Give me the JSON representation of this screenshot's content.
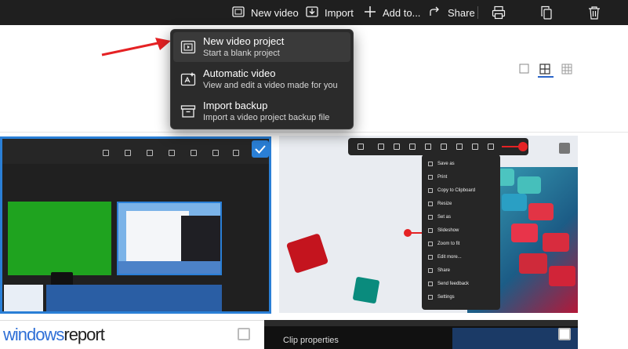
{
  "toolbar": {
    "new_video": "New video",
    "import": "Import",
    "add_to": "Add to...",
    "share": "Share"
  },
  "menu": {
    "items": [
      {
        "title": "New video project",
        "subtitle": "Start a blank project"
      },
      {
        "title": "Automatic video",
        "subtitle": "View and edit a video made for you"
      },
      {
        "title": "Import backup",
        "subtitle": "Import a video project backup file"
      }
    ]
  },
  "thumb_right": {
    "context_menu": [
      "Save as",
      "Print",
      "Copy to Clipboard",
      "Resize",
      "Set as",
      "Slideshow",
      "Zoom to fit",
      "Edit more...",
      "Share",
      "Send feedback",
      "Settings"
    ]
  },
  "bottom": {
    "brand_windows": "windows",
    "brand_report": "report",
    "clip_properties": "Clip properties"
  },
  "colors": {
    "accent": "#2a7fd6",
    "arrow": "#e52224"
  }
}
